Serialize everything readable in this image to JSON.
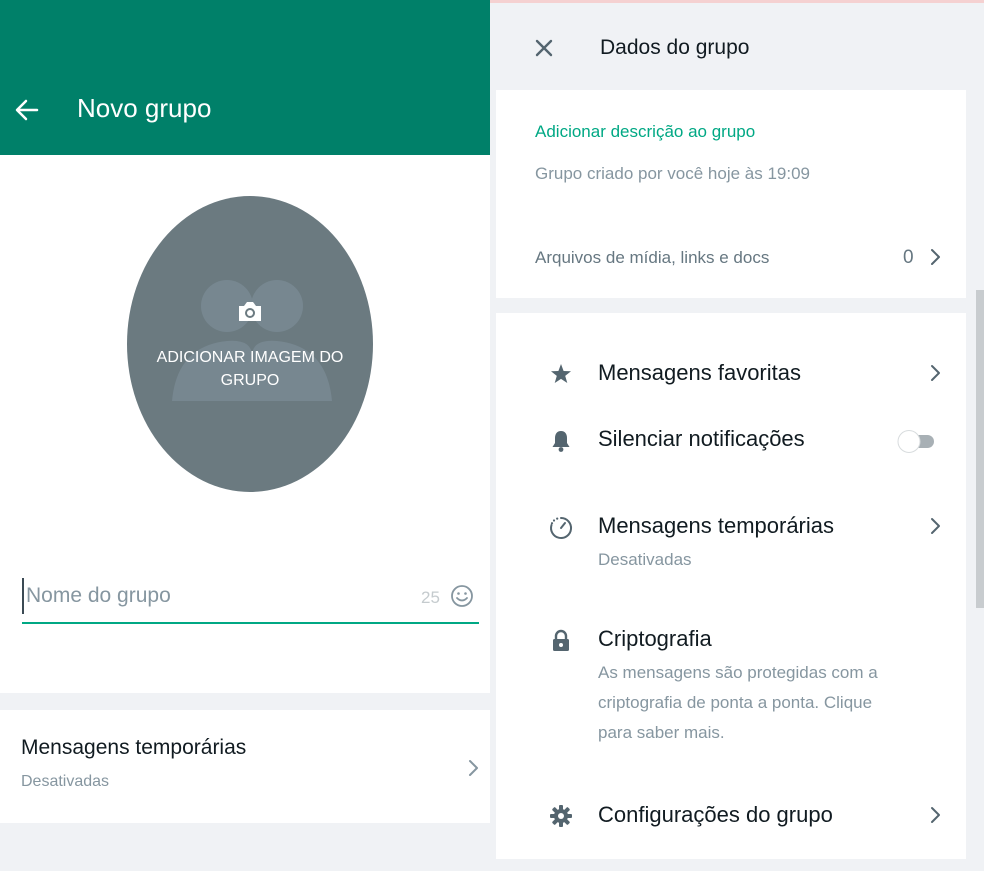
{
  "left": {
    "title": "Novo grupo",
    "avatar_label": "ADICIONAR IMAGEM DO GRUPO",
    "name_placeholder": "Nome do grupo",
    "char_count": "25",
    "temp_messages_title": "Mensagens temporárias",
    "temp_messages_status": "Desativadas"
  },
  "right": {
    "title": "Dados do grupo",
    "add_description": "Adicionar descrição ao grupo",
    "created_info": "Grupo criado por você hoje às 19:09",
    "media_label": "Arquivos de mídia, links e docs",
    "media_count": "0",
    "options": {
      "favorites": "Mensagens favoritas",
      "mute": "Silenciar notificações",
      "temp_title": "Mensagens temporárias",
      "temp_status": "Desativadas",
      "crypto_title": "Criptografia",
      "crypto_desc": "As mensagens são protegidas com a criptografia de ponta a ponta. Clique para saber mais.",
      "settings": "Configurações do grupo"
    },
    "mute_enabled": false
  },
  "colors": {
    "header_green": "#008069",
    "accent_green": "#00a884",
    "icon_gray": "#54656f",
    "avatar_gray": "#6b7a80"
  },
  "icons": {
    "back": "arrow-left-icon",
    "camera": "camera-icon",
    "emoji": "smiley-icon",
    "chevron": "chevron-right-icon",
    "close": "close-icon",
    "star": "star-icon",
    "bell": "bell-icon",
    "timer": "timer-icon",
    "lock": "lock-icon",
    "gear": "gear-icon"
  }
}
